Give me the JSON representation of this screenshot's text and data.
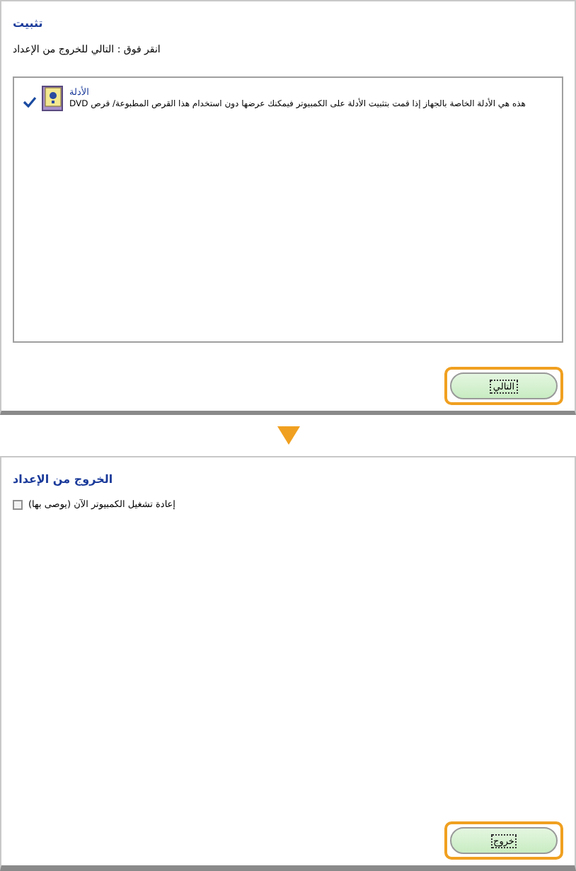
{
  "install_panel": {
    "title": "تثبيت",
    "instruction": "انقر فوق : التالي للخروج من الإعداد",
    "items": [
      {
        "checked": true,
        "title": "الأدلة",
        "description": "هذه هي الأدلة الخاصة بالجهاز إذا قمت بتثبيت الأدلة على الكمبيوتر فيمكنك عرضها دون استخدام هذا القرص المطبوعة/ قرص DVD"
      }
    ],
    "button": "التالي"
  },
  "exit_panel": {
    "title": "الخروج من الإعداد",
    "restart_option": {
      "label": "إعادة تشغيل الكمبيوتر الآن (يوصى بها)",
      "checked": false
    },
    "button": "خروج"
  }
}
